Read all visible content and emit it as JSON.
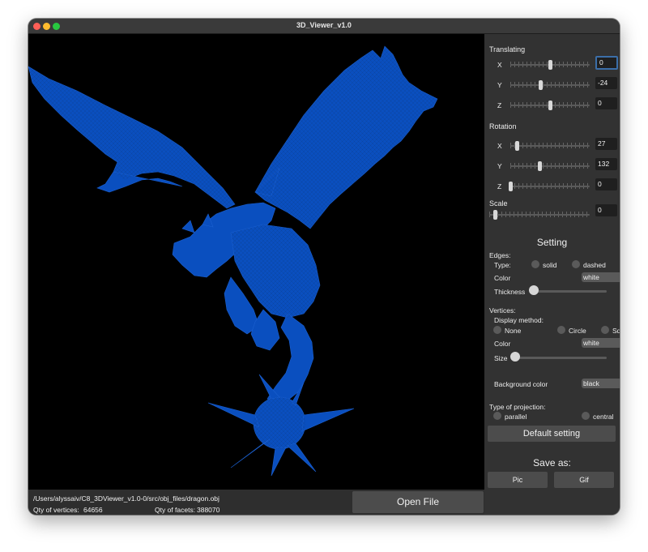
{
  "window": {
    "title": "3D_Viewer_v1.0"
  },
  "status": {
    "file_path": "/Users/alyssaiv/C8_3DViewer_v1.0-0/src/obj_files/dragon.obj",
    "vertices_label": "Qty of vertices:",
    "vertices_value": "64656",
    "facets_label": "Qty of facets:",
    "facets_value": "388070",
    "open_file_label": "Open File"
  },
  "model": {
    "color": "#0a4fbf",
    "icon": "dragon-wireframe"
  },
  "translating": {
    "label": "Translating",
    "x": {
      "label": "X",
      "value": "0",
      "fraction": 0.5
    },
    "y": {
      "label": "Y",
      "value": "-24",
      "fraction": 0.38
    },
    "z": {
      "label": "Z",
      "value": "0",
      "fraction": 0.5
    }
  },
  "rotation": {
    "label": "Rotation",
    "x": {
      "label": "X",
      "value": "27",
      "fraction": 0.08
    },
    "y": {
      "label": "Y",
      "value": "132",
      "fraction": 0.37
    },
    "z": {
      "label": "Z",
      "value": "0",
      "fraction": 0.0
    }
  },
  "scale": {
    "label": "Scale",
    "value": "0",
    "fraction": 0.06
  },
  "setting": {
    "title": "Setting",
    "edges": {
      "label": "Edges:",
      "type_label": "Type:",
      "solid_label": "solid",
      "dashed_label": "dashed",
      "color_label": "Color",
      "color_value": "white",
      "thickness_label": "Thickness",
      "thickness_fraction": 0.0
    },
    "vertices": {
      "label": "Vertices:",
      "display_label": "Display method:",
      "none_label": "None",
      "circle_label": "Circle",
      "square_label": "Square",
      "color_label": "Color",
      "color_value": "white",
      "size_label": "Size",
      "size_fraction": 0.0
    },
    "background_label": "Background color",
    "background_value": "black",
    "projection": {
      "label": "Type of projection:",
      "parallel_label": "parallel",
      "central_label": "central"
    },
    "default_button_label": "Default setting"
  },
  "save": {
    "title": "Save as:",
    "pic_label": "Pic",
    "gif_label": "Gif"
  },
  "colors": {
    "accent": "#2e6fd8",
    "panel": "#323232",
    "viewport": "#000000"
  }
}
